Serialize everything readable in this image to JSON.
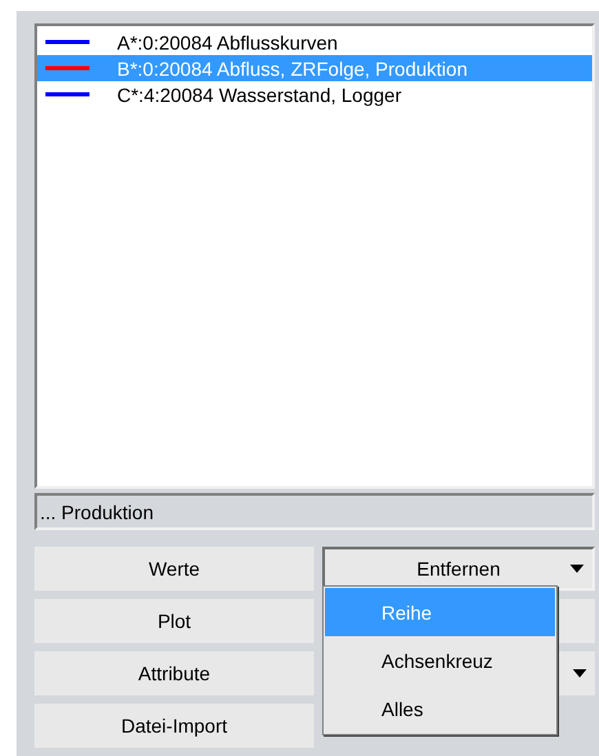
{
  "series_list": [
    {
      "label": "A*:0:20084  Abflusskurven",
      "color": "#0000ff",
      "selected": false
    },
    {
      "label": "B*:0:20084  Abfluss, ZRFolge, Produktion",
      "color": "#ff0000",
      "selected": true
    },
    {
      "label": "C*:4:20084  Wasserstand, Logger",
      "color": "#0000ff",
      "selected": false
    }
  ],
  "status_field": {
    "value": "... Produktion"
  },
  "left_buttons": [
    "Werte",
    "Plot",
    "Attribute",
    "Datei-Import"
  ],
  "remove_dropdown": {
    "label": "Entfernen",
    "expanded": true,
    "options": [
      {
        "label": "Reihe",
        "selected": true
      },
      {
        "label": "Achsenkreuz",
        "selected": false
      },
      {
        "label": "Alles",
        "selected": false
      }
    ]
  }
}
